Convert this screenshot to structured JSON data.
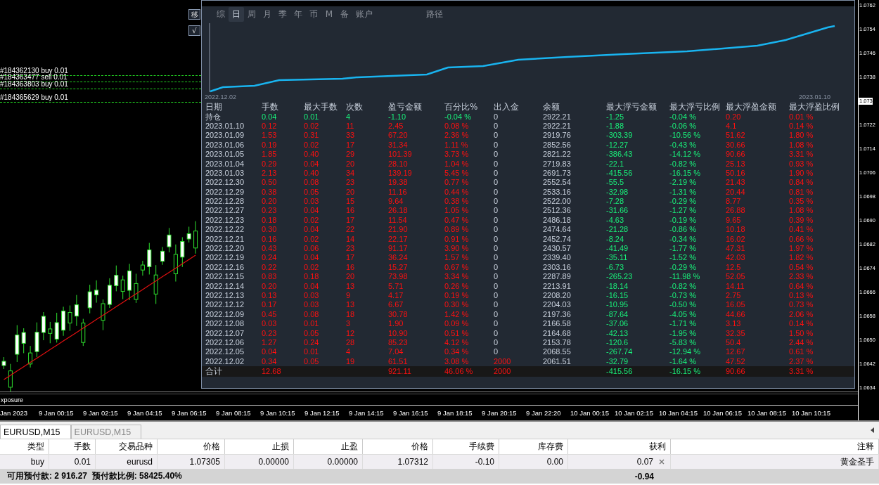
{
  "chart": {
    "orders": [
      "#184362130 buy 0.01",
      "#184363477 sell 0.01",
      "#184363803 buy 0.01",
      "#184365629 buy 0.01"
    ],
    "tool_buttons": [
      "移",
      "√"
    ],
    "price_axis": [
      {
        "label": "1.0762",
        "kind": "tick"
      },
      {
        "label": "1.0754",
        "kind": "tick"
      },
      {
        "label": "1.0746",
        "kind": "tick"
      },
      {
        "label": "1.0738",
        "kind": "tick"
      },
      {
        "label": "1.073",
        "kind": "current"
      },
      {
        "label": "1.0722",
        "kind": "tick"
      },
      {
        "label": "1.0714",
        "kind": "tick"
      },
      {
        "label": "1.0706",
        "kind": "tick"
      },
      {
        "label": "1.0698",
        "kind": "tick"
      },
      {
        "label": "1.0690",
        "kind": "tick"
      },
      {
        "label": "1.0682",
        "kind": "tick"
      },
      {
        "label": "1.0674",
        "kind": "tick"
      },
      {
        "label": "1.0666",
        "kind": "tick"
      },
      {
        "label": "1.0658",
        "kind": "tick"
      },
      {
        "label": "1.0650",
        "kind": "tick"
      },
      {
        "label": "1.0642",
        "kind": "tick"
      },
      {
        "label": "1.0634",
        "kind": "tick"
      }
    ],
    "indicator_label": "xposure",
    "time_axis": [
      "Jan 2023",
      "9 Jan 00:15",
      "9 Jan 02:15",
      "9 Jan 04:15",
      "9 Jan 06:15",
      "9 Jan 08:15",
      "9 Jan 10:15",
      "9 Jan 12:15",
      "9 Jan 14:15",
      "9 Jan 16:15",
      "9 Jan 18:15",
      "9 Jan 20:15",
      "9 Jan 22:20",
      "10 Jan 00:15",
      "10 Jan 02:15",
      "10 Jan 04:15",
      "10 Jan 06:15",
      "10 Jan 08:15",
      "10 Jan 10:15"
    ]
  },
  "stats_panel": {
    "tabs": [
      {
        "label": "综",
        "selected": false
      },
      {
        "label": "日",
        "selected": true
      },
      {
        "label": "周",
        "selected": false
      },
      {
        "label": "月",
        "selected": false
      },
      {
        "label": "季",
        "selected": false
      },
      {
        "label": "年",
        "selected": false
      },
      {
        "label": "币",
        "selected": false
      },
      {
        "label": "M",
        "selected": false
      },
      {
        "label": "备",
        "selected": false
      },
      {
        "label": "账户",
        "selected": false
      },
      {
        "label": "路径",
        "selected": false
      }
    ],
    "equity_chart": {
      "start_label": "2022.12.02",
      "end_label": "2023.01.10"
    },
    "columns": [
      "日期",
      "手数",
      "最大手数",
      "次数",
      "盈亏金额",
      "百分比%",
      "出入金",
      "余额",
      "最大浮亏金额",
      "最大浮亏比例",
      "最大浮盈金额",
      "最大浮盈比例"
    ],
    "rows": [
      {
        "kind": "position",
        "flow_highlight": false,
        "cells": [
          "持仓",
          "0.04",
          "0.01",
          "4",
          "-1.10",
          "-0.04 %",
          "0",
          "2922.21",
          "-1.25",
          "-0.04 %",
          "0.20",
          "0.01 %"
        ]
      },
      {
        "kind": "day",
        "flow_highlight": false,
        "cells": [
          "2023.01.10",
          "0.12",
          "0.02",
          "11",
          "2.45",
          "0.08 %",
          "0",
          "2922.21",
          "-1.88",
          "-0.06 %",
          "4.1",
          "0.14 %"
        ]
      },
      {
        "kind": "day",
        "flow_highlight": false,
        "cells": [
          "2023.01.09",
          "1.53",
          "0.31",
          "33",
          "67.20",
          "2.36 %",
          "0",
          "2919.76",
          "-303.39",
          "-10.56 %",
          "51.62",
          "1.80 %"
        ]
      },
      {
        "kind": "day",
        "flow_highlight": false,
        "cells": [
          "2023.01.06",
          "0.19",
          "0.02",
          "17",
          "31.34",
          "1.11 %",
          "0",
          "2852.56",
          "-12.27",
          "-0.43 %",
          "30.66",
          "1.08 %"
        ]
      },
      {
        "kind": "day",
        "flow_highlight": false,
        "cells": [
          "2023.01.05",
          "1.85",
          "0.40",
          "29",
          "101.39",
          "3.73 %",
          "0",
          "2821.22",
          "-386.43",
          "-14.12 %",
          "90.66",
          "3.31 %"
        ]
      },
      {
        "kind": "day",
        "flow_highlight": false,
        "cells": [
          "2023.01.04",
          "0.29",
          "0.04",
          "20",
          "28.10",
          "1.04 %",
          "0",
          "2719.83",
          "-22.1",
          "-0.82 %",
          "25.13",
          "0.93 %"
        ]
      },
      {
        "kind": "day",
        "flow_highlight": false,
        "cells": [
          "2023.01.03",
          "2.13",
          "0.40",
          "34",
          "139.19",
          "5.45 %",
          "0",
          "2691.73",
          "-415.56",
          "-16.15 %",
          "50.16",
          "1.90 %"
        ]
      },
      {
        "kind": "day",
        "flow_highlight": false,
        "cells": [
          "2022.12.30",
          "0.50",
          "0.08",
          "23",
          "19.38",
          "0.77 %",
          "0",
          "2552.54",
          "-55.5",
          "-2.19 %",
          "21.43",
          "0.84 %"
        ]
      },
      {
        "kind": "day",
        "flow_highlight": false,
        "cells": [
          "2022.12.29",
          "0.38",
          "0.05",
          "20",
          "11.16",
          "0.44 %",
          "0",
          "2533.16",
          "-32.98",
          "-1.31 %",
          "20.44",
          "0.81 %"
        ]
      },
      {
        "kind": "day",
        "flow_highlight": false,
        "cells": [
          "2022.12.28",
          "0.20",
          "0.03",
          "15",
          "9.64",
          "0.38 %",
          "0",
          "2522.00",
          "-7.28",
          "-0.29 %",
          "8.77",
          "0.35 %"
        ]
      },
      {
        "kind": "day",
        "flow_highlight": false,
        "cells": [
          "2022.12.27",
          "0.23",
          "0.04",
          "16",
          "26.18",
          "1.05 %",
          "0",
          "2512.36",
          "-31.66",
          "-1.27 %",
          "26.88",
          "1.08 %"
        ]
      },
      {
        "kind": "day",
        "flow_highlight": false,
        "cells": [
          "2022.12.23",
          "0.18",
          "0.02",
          "17",
          "11.54",
          "0.47 %",
          "0",
          "2486.18",
          "-4.63",
          "-0.19 %",
          "9.65",
          "0.39 %"
        ]
      },
      {
        "kind": "day",
        "flow_highlight": false,
        "cells": [
          "2022.12.22",
          "0.30",
          "0.04",
          "22",
          "21.90",
          "0.89 %",
          "0",
          "2474.64",
          "-21.28",
          "-0.86 %",
          "10.18",
          "0.41 %"
        ]
      },
      {
        "kind": "day",
        "flow_highlight": false,
        "cells": [
          "2022.12.21",
          "0.16",
          "0.02",
          "14",
          "22.17",
          "0.91 %",
          "0",
          "2452.74",
          "-8.24",
          "-0.34 %",
          "16.02",
          "0.66 %"
        ]
      },
      {
        "kind": "day",
        "flow_highlight": false,
        "cells": [
          "2022.12.20",
          "0.43",
          "0.06",
          "23",
          "91.17",
          "3.90 %",
          "0",
          "2430.57",
          "-41.49",
          "-1.77 %",
          "47.31",
          "1.97 %"
        ]
      },
      {
        "kind": "day",
        "flow_highlight": false,
        "cells": [
          "2022.12.19",
          "0.24",
          "0.04",
          "17",
          "36.24",
          "1.57 %",
          "0",
          "2339.40",
          "-35.11",
          "-1.52 %",
          "42.03",
          "1.82 %"
        ]
      },
      {
        "kind": "day",
        "flow_highlight": false,
        "cells": [
          "2022.12.16",
          "0.22",
          "0.02",
          "16",
          "15.27",
          "0.67 %",
          "0",
          "2303.16",
          "-6.73",
          "-0.29 %",
          "12.5",
          "0.54 %"
        ]
      },
      {
        "kind": "day",
        "flow_highlight": false,
        "cells": [
          "2022.12.15",
          "0.83",
          "0.18",
          "20",
          "73.98",
          "3.34 %",
          "0",
          "2287.89",
          "-265.23",
          "-11.98 %",
          "52.05",
          "2.33 %"
        ]
      },
      {
        "kind": "day",
        "flow_highlight": false,
        "cells": [
          "2022.12.14",
          "0.20",
          "0.04",
          "13",
          "5.71",
          "0.26 %",
          "0",
          "2213.91",
          "-18.14",
          "-0.82 %",
          "14.11",
          "0.64 %"
        ]
      },
      {
        "kind": "day",
        "flow_highlight": false,
        "cells": [
          "2022.12.13",
          "0.13",
          "0.03",
          "9",
          "4.17",
          "0.19 %",
          "0",
          "2208.20",
          "-16.15",
          "-0.73 %",
          "2.75",
          "0.13 %"
        ]
      },
      {
        "kind": "day",
        "flow_highlight": false,
        "cells": [
          "2022.12.12",
          "0.17",
          "0.03",
          "13",
          "6.67",
          "0.30 %",
          "0",
          "2204.03",
          "-10.95",
          "-0.50 %",
          "16.05",
          "0.73 %"
        ]
      },
      {
        "kind": "day",
        "flow_highlight": false,
        "cells": [
          "2022.12.09",
          "0.45",
          "0.08",
          "18",
          "30.78",
          "1.42 %",
          "0",
          "2197.36",
          "-87.64",
          "-4.05 %",
          "44.66",
          "2.06 %"
        ]
      },
      {
        "kind": "day",
        "flow_highlight": false,
        "cells": [
          "2022.12.08",
          "0.03",
          "0.01",
          "3",
          "1.90",
          "0.09 %",
          "0",
          "2166.58",
          "-37.06",
          "-1.71 %",
          "3.13",
          "0.14 %"
        ]
      },
      {
        "kind": "day",
        "flow_highlight": false,
        "cells": [
          "2022.12.07",
          "0.23",
          "0.05",
          "12",
          "10.90",
          "0.51 %",
          "0",
          "2164.68",
          "-42.13",
          "-1.95 %",
          "32.35",
          "1.50 %"
        ]
      },
      {
        "kind": "day",
        "flow_highlight": false,
        "cells": [
          "2022.12.06",
          "1.27",
          "0.24",
          "28",
          "85.23",
          "4.12 %",
          "0",
          "2153.78",
          "-120.6",
          "-5.83 %",
          "50.4",
          "2.44 %"
        ]
      },
      {
        "kind": "day",
        "flow_highlight": false,
        "cells": [
          "2022.12.05",
          "0.04",
          "0.01",
          "4",
          "7.04",
          "0.34 %",
          "0",
          "2068.55",
          "-267.74",
          "-12.94 %",
          "12.67",
          "0.61 %"
        ]
      },
      {
        "kind": "day",
        "flow_highlight": true,
        "cells": [
          "2022.12.02",
          "0.34",
          "0.05",
          "19",
          "61.51",
          "3.08 %",
          "2000",
          "2061.51",
          "-32.79",
          "-1.64 %",
          "47.52",
          "2.37 %"
        ]
      },
      {
        "kind": "total",
        "flow_highlight": true,
        "cells": [
          "合计",
          "12.68",
          null,
          null,
          "921.11",
          "46.06 %",
          "2000",
          null,
          "-415.56",
          "-16.15 %",
          "90.66",
          "3.31 %"
        ]
      }
    ]
  },
  "chart_tabs": [
    {
      "label": "EURUSD,M15",
      "selected": true
    },
    {
      "label": "EURUSD,M15",
      "selected": false
    }
  ],
  "trade_table": {
    "columns": [
      "类型",
      "手数",
      "交易品种",
      "价格",
      "止损",
      "止盈",
      "价格",
      "手续费",
      "库存费",
      "获利",
      "注释"
    ],
    "rows": [
      {
        "cells": [
          "buy",
          "0.01",
          "eurusd",
          "1.07305",
          "0.00000",
          "0.00000",
          "1.07312",
          "-0.10",
          "0.00",
          "0.07",
          "黄金圣手"
        ]
      }
    ],
    "summary": {
      "text": "可用预付款: 2 916.27  预付款比例: 58425.40%",
      "profit": "-0.94"
    }
  }
}
